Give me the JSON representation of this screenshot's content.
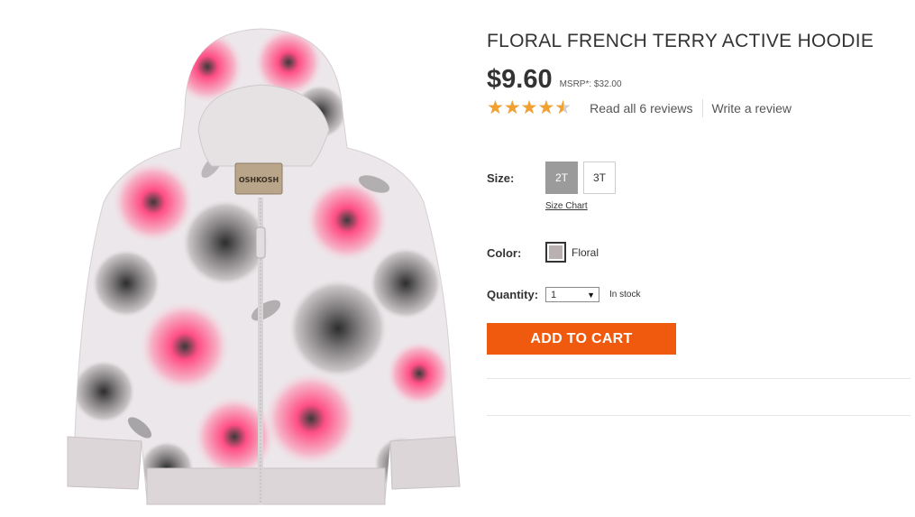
{
  "product": {
    "title": "FLORAL FRENCH TERRY ACTIVE HOODIE",
    "price": "$9.60",
    "msrp": "MSRP*: $32.00",
    "rating": 4.5,
    "rating_max": 5,
    "stars_glyphs": "★★★★★",
    "read_reviews_link": "Read all 6 reviews",
    "write_review_link": "Write a review",
    "image_brand_tag": "OSHKOSH"
  },
  "options": {
    "size_label": "Size:",
    "sizes": [
      "2T",
      "3T"
    ],
    "selected_size": "2T",
    "size_chart_link": "Size Chart",
    "color_label": "Color:",
    "color_name": "Floral",
    "quantity_label": "Quantity:",
    "quantity_value": "1",
    "quantity_arrow": "▼",
    "stock_status": "In stock"
  },
  "cart": {
    "add_to_cart_label": "ADD TO CART"
  },
  "colors": {
    "accent_orange": "#f05a0f",
    "star_gold": "#f1a132",
    "selected_size_bg": "#9b9b9b",
    "text_dark": "#333333"
  },
  "icons": {
    "rating": "star-icon",
    "dropdown": "chevron-down-icon"
  }
}
